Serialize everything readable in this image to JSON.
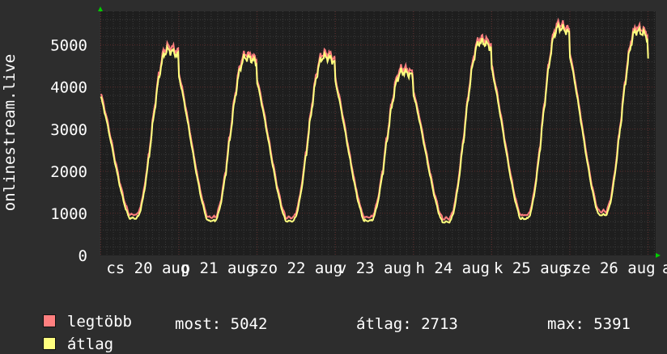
{
  "chart_data": {
    "type": "line",
    "ylabel": "onlinestream.live",
    "ylim": [
      0,
      5800
    ],
    "yticks": [
      0,
      1000,
      2000,
      3000,
      4000,
      5000
    ],
    "ytick_labels": [
      "0",
      "1000",
      "2000",
      "3000",
      "4000",
      "5000"
    ],
    "xtick_labels": [
      "cs 20 aug",
      "p 21 aug",
      "szo 22 aug",
      "v 23 aug",
      "h 24 aug",
      "k 25 aug",
      "sze 26 aug"
    ],
    "x_days": [
      0,
      1,
      2,
      3,
      4,
      5,
      6,
      7,
      8
    ],
    "daily_peaks": [
      4870,
      4700,
      4720,
      4360,
      5070,
      5410,
      5330
    ],
    "daily_troughs": [
      880,
      820,
      810,
      820,
      790,
      870,
      960
    ],
    "series": [
      {
        "name": "legtöbb",
        "color": "#ff7f7f"
      },
      {
        "name": "átlag",
        "color": "#ffff7f"
      }
    ],
    "grid": true
  },
  "legend": {
    "max_label": "legtöbb",
    "avg_label": "átlag",
    "now_text": "most: 5042",
    "avg_text": "átlag: 2713",
    "max_text": "max: 5391"
  },
  "colors": {
    "background": "#2d2d2d",
    "plot_background": "#1e1e1e",
    "grid_major": "#5a2a2a",
    "grid_minor": "#3a3a3a",
    "axis_arrow": "#00cc00"
  }
}
